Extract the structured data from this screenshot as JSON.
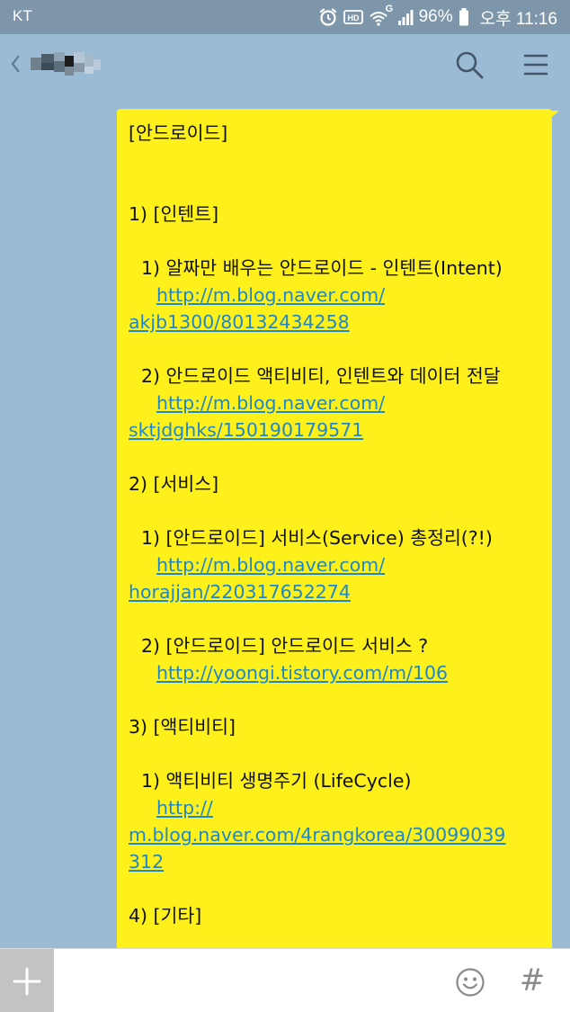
{
  "status": {
    "carrier": "KT",
    "network_type": "G",
    "battery": "96%",
    "time": "오후 11:16",
    "icons": [
      "alarm-icon",
      "hd-icon",
      "wifi-icon",
      "signal-icon",
      "battery-icon"
    ]
  },
  "header": {
    "icons": [
      "back-icon",
      "search-icon",
      "menu-icon"
    ]
  },
  "message": {
    "lines": {
      "title": "[안드로이드]",
      "s1": "1) [인텐트]",
      "s1i1": "1) 알짜만 배우는 안드로이드 - 인텐트(Intent)",
      "s1i1_link_a": "http://m.blog.naver.com/",
      "s1i1_link_b": "akjb1300/80132434258",
      "s1i2": "2) 안드로이드 액티비티, 인텐트와 데이터 전달",
      "s1i2_link_a": "http://m.blog.naver.com/",
      "s1i2_link_b": "sktjdghks/150190179571",
      "s2": "2) [서비스]",
      "s2i1": "1) [안드로이드] 서비스(Service) 총정리(?!)",
      "s2i1_link_a": "http://m.blog.naver.com/",
      "s2i1_link_b": "horajjan/220317652274",
      "s2i2": "2) [안드로이드] 안드로이드 서비스 ?",
      "s2i2_link": "http://yoongi.tistory.com/m/106",
      "s3": "3) [액티비티]",
      "s3i1": "1) 액티비티 생명주기 (LifeCycle)",
      "s3i1_link_a": "http://",
      "s3i1_link_b": "m.blog.naver.com/4rangkorea/30099039",
      "s3i1_link_c": "312",
      "s4": "4) [기타]"
    }
  },
  "colors": {
    "chat_background": "#9bbbd4",
    "status_bar": "#7d96aa",
    "bubble": "#fef01b",
    "link": "#1e88c8"
  },
  "input": {
    "value": "",
    "placeholder": "",
    "hash_label": "#",
    "icons": [
      "plus-icon",
      "emoji-icon"
    ]
  }
}
